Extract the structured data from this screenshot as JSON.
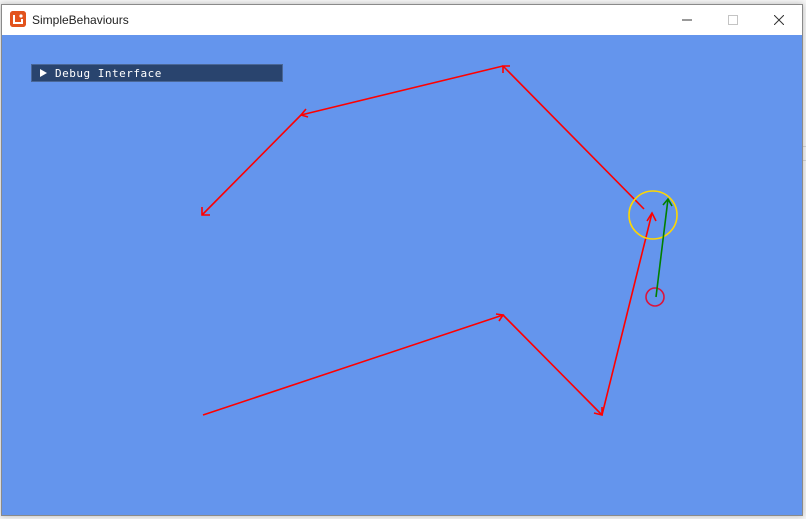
{
  "window": {
    "title": "SimpleBehaviours",
    "minimize_icon": "minimize-icon",
    "maximize_icon": "maximize-icon",
    "close_icon": "close-icon",
    "app_icon": "monogame-app-icon"
  },
  "debug_interface": {
    "label": "Debug Interface",
    "expanded": false,
    "icon": "collapse-triangle-icon"
  },
  "scene": {
    "background_color": "#6495ed",
    "path_color": "#ff0000",
    "agent_color": "#008000",
    "target_color": "#ffd700",
    "agent_marker_color": "#dc143c"
  }
}
